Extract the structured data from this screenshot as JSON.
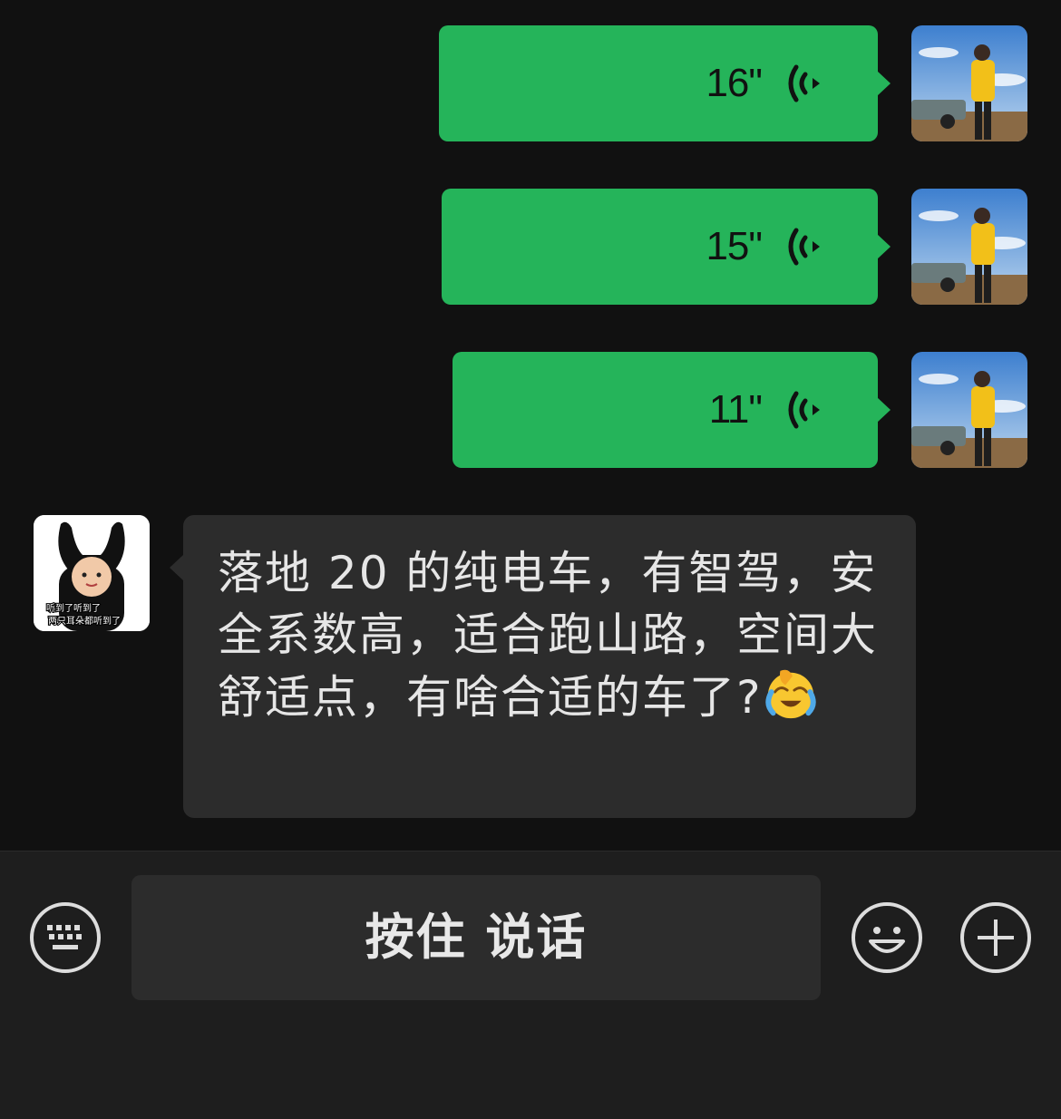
{
  "colors": {
    "background": "#111111",
    "sent_bubble": "#25b45a",
    "received_bubble": "#2c2c2c",
    "toolbar": "#1e1e1e",
    "text": "#e6e6e6"
  },
  "messages": [
    {
      "type": "voice",
      "direction": "sent",
      "duration": "16\"",
      "icon": "voice-wave-icon",
      "avatar": "user-avatar-photo"
    },
    {
      "type": "voice",
      "direction": "sent",
      "duration": "15\"",
      "icon": "voice-wave-icon",
      "avatar": "user-avatar-photo"
    },
    {
      "type": "voice",
      "direction": "sent",
      "duration": "11\"",
      "icon": "voice-wave-icon",
      "avatar": "user-avatar-photo"
    },
    {
      "type": "text",
      "direction": "received",
      "text": "落地 20 的纯电车，有智驾，安全系数高，适合跑山路，空间大舒适点，有啥合适的车了?",
      "emoji": "face-with-tears-emoji",
      "avatar": "contact-avatar-sticker",
      "avatar_caption_line1": "听到了听到了",
      "avatar_caption_line2": "两只耳朵都听到了"
    }
  ],
  "toolbar": {
    "keyboard_icon": "keyboard-icon",
    "hold_to_talk_label": "按住 说话",
    "emoji_icon": "smiley-icon",
    "more_icon": "plus-icon"
  }
}
